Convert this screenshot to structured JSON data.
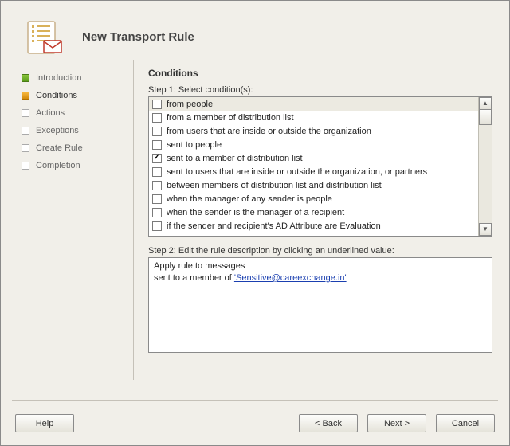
{
  "header": {
    "title": "New Transport Rule"
  },
  "nav": {
    "items": [
      {
        "label": "Introduction",
        "state": "done"
      },
      {
        "label": "Conditions",
        "state": "current"
      },
      {
        "label": "Actions",
        "state": "future"
      },
      {
        "label": "Exceptions",
        "state": "future"
      },
      {
        "label": "Create Rule",
        "state": "future"
      },
      {
        "label": "Completion",
        "state": "future"
      }
    ]
  },
  "main": {
    "section_title": "Conditions",
    "step1_label": "Step 1: Select condition(s):",
    "conditions": [
      {
        "label": "from people",
        "checked": false,
        "highlight": true
      },
      {
        "label": "from a member of distribution list",
        "checked": false
      },
      {
        "label": "from users that are inside or outside the organization",
        "checked": false
      },
      {
        "label": "sent to people",
        "checked": false
      },
      {
        "label": "sent to a member of distribution list",
        "checked": true
      },
      {
        "label": "sent to users that are inside or outside the organization, or partners",
        "checked": false
      },
      {
        "label": "between members of distribution list and distribution list",
        "checked": false
      },
      {
        "label": "when the manager of any sender is people",
        "checked": false
      },
      {
        "label": "when the sender is the manager of a recipient",
        "checked": false
      },
      {
        "label": "if the sender and recipient's AD Attribute are Evaluation",
        "checked": false
      }
    ],
    "step2_label": "Step 2: Edit the rule description by clicking an underlined value:",
    "description": {
      "line1": "Apply rule to messages",
      "line2_prefix": "sent to a member of ",
      "line2_link": "'Sensitive@careexchange.in'"
    }
  },
  "footer": {
    "help": "Help",
    "back": "< Back",
    "next": "Next >",
    "cancel": "Cancel"
  }
}
